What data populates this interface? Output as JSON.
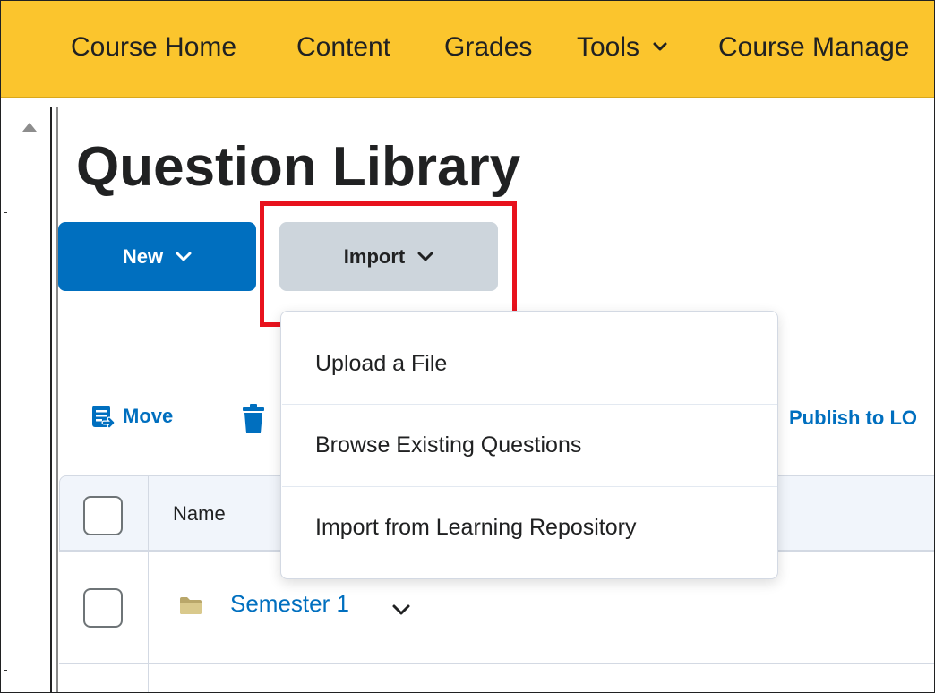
{
  "nav": {
    "items": [
      {
        "label": "Course Home"
      },
      {
        "label": "Content"
      },
      {
        "label": "Grades"
      },
      {
        "label": "Tools"
      },
      {
        "label": "Course Manage"
      }
    ]
  },
  "page": {
    "title": "Question Library"
  },
  "buttons": {
    "new_label": "New",
    "import_label": "Import"
  },
  "toolbar": {
    "move_label": "Move",
    "publish_label": "Publish to LO"
  },
  "import_menu": {
    "items": [
      {
        "label": "Upload a File"
      },
      {
        "label": "Browse Existing Questions"
      },
      {
        "label": "Import from Learning Repository"
      }
    ]
  },
  "table": {
    "columns": [
      "Name"
    ],
    "rows": [
      {
        "name": "Semester 1"
      }
    ]
  },
  "colors": {
    "navbar": "#fbc52d",
    "primary": "#006fbf",
    "secondary_button": "#cdd5dc",
    "highlight": "#e8121d"
  }
}
